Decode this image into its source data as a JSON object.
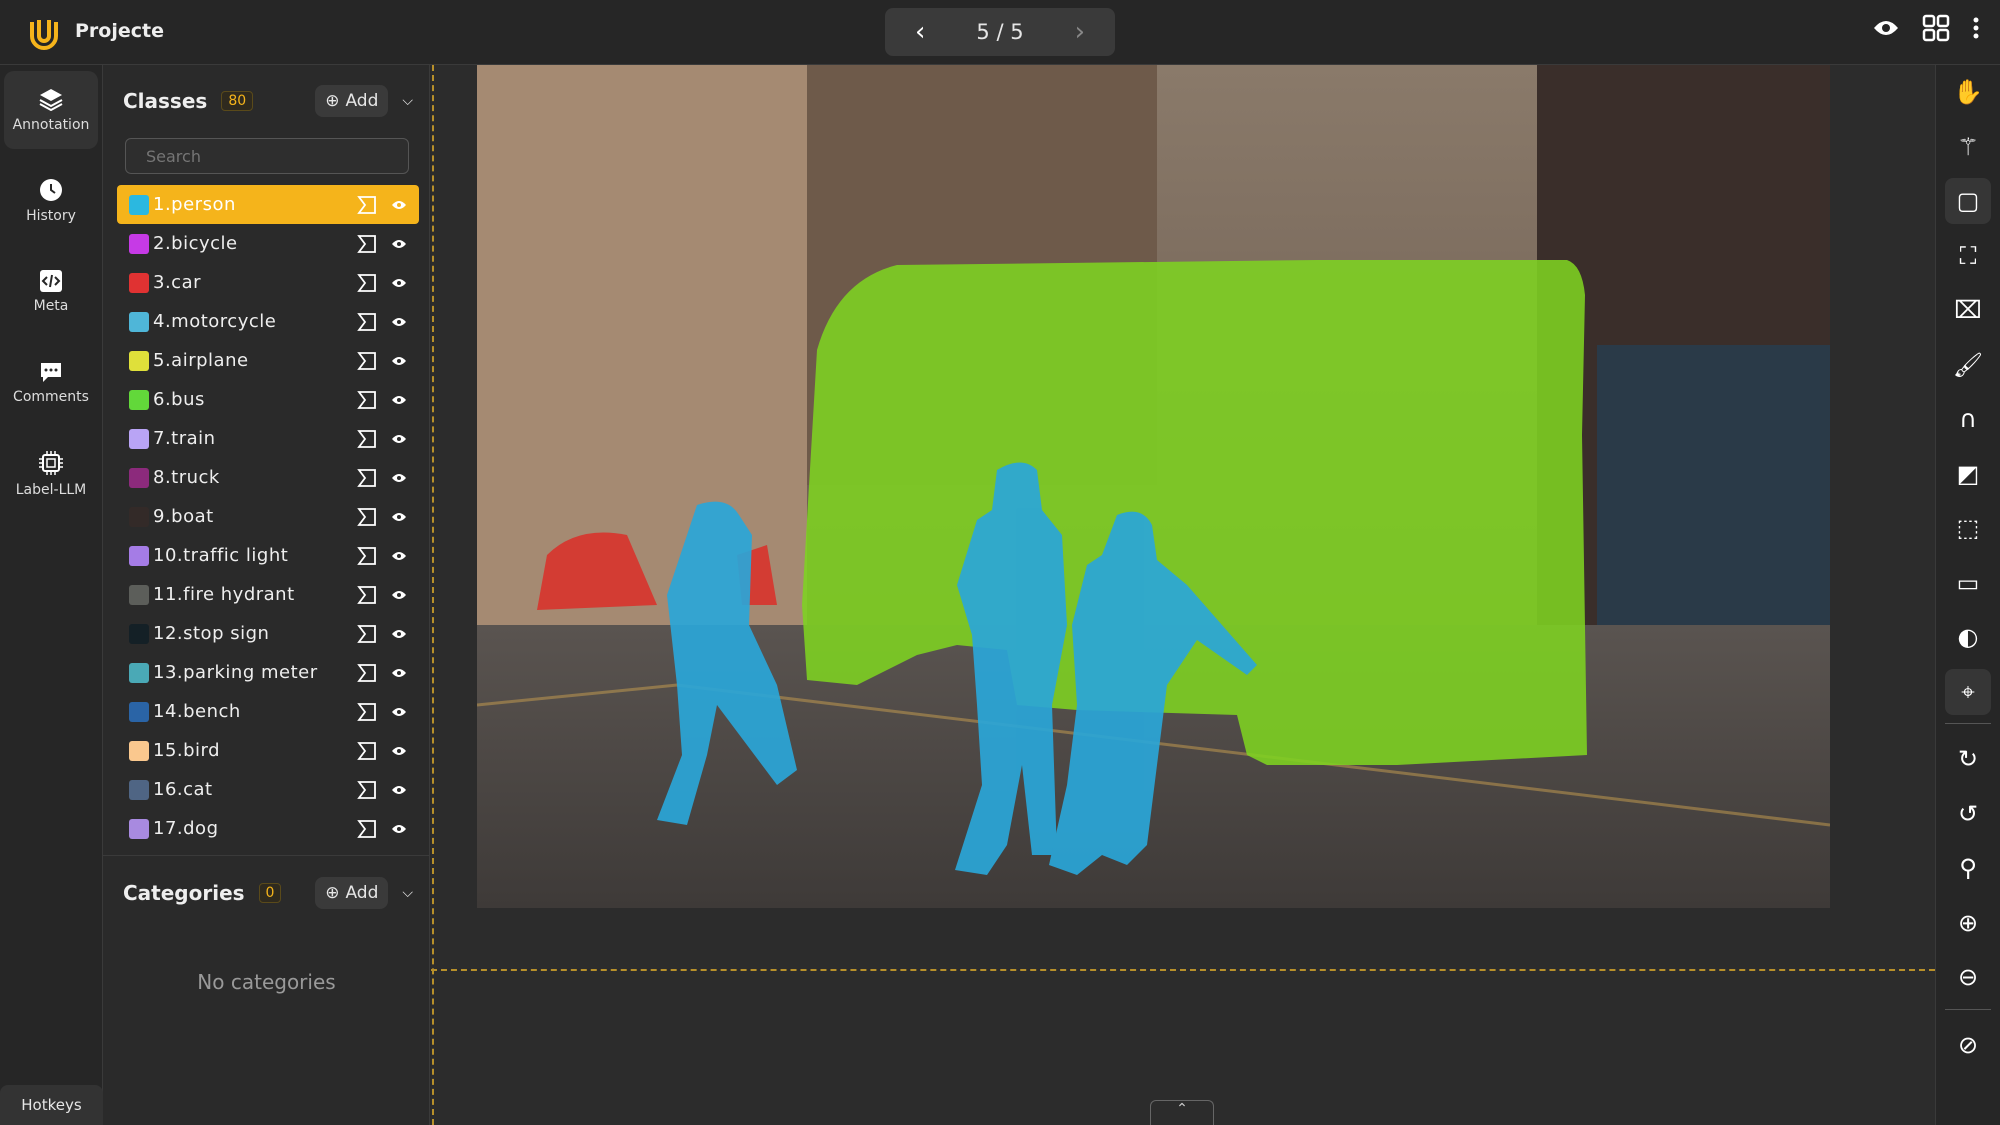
{
  "header": {
    "project": "Projecte",
    "pager": "5 / 5",
    "prev_icon": "chevron-left-icon",
    "next_icon": "chevron-right-icon"
  },
  "nav": [
    {
      "label": "Annotation",
      "icon": "layers-icon",
      "active": true
    },
    {
      "label": "History",
      "icon": "clock-icon"
    },
    {
      "label": "Meta",
      "icon": "code-icon"
    },
    {
      "label": "Comments",
      "icon": "comment-icon"
    },
    {
      "label": "Label-LLM",
      "icon": "chip-icon"
    }
  ],
  "hotkeys": "Hotkeys",
  "classes": {
    "title": "Classes",
    "count": "80",
    "add_label": "Add",
    "search_placeholder": "Search",
    "items": [
      {
        "label": "1.person",
        "color": "#2bb8e0",
        "selected": true
      },
      {
        "label": "2.bicycle",
        "color": "#c63ae6"
      },
      {
        "label": "3.car",
        "color": "#e03232"
      },
      {
        "label": "4.motorcycle",
        "color": "#4fb6d8"
      },
      {
        "label": "5.airplane",
        "color": "#dfe03a"
      },
      {
        "label": "6.bus",
        "color": "#62d83a"
      },
      {
        "label": "7.train",
        "color": "#b9a4f5"
      },
      {
        "label": "8.truck",
        "color": "#8c2a7c"
      },
      {
        "label": "9.boat",
        "color": "#332a28"
      },
      {
        "label": "10.traffic light",
        "color": "#a57ce6"
      },
      {
        "label": "11.fire hydrant",
        "color": "#5c5e5a"
      },
      {
        "label": "12.stop sign",
        "color": "#142026"
      },
      {
        "label": "13.parking meter",
        "color": "#4aa9b6"
      },
      {
        "label": "14.bench",
        "color": "#2a64a6"
      },
      {
        "label": "15.bird",
        "color": "#fac88e"
      },
      {
        "label": "16.cat",
        "color": "#4f6584"
      },
      {
        "label": "17.dog",
        "color": "#a88ae0"
      }
    ]
  },
  "categories": {
    "title": "Categories",
    "count": "0",
    "add_label": "Add",
    "empty": "No categories"
  },
  "tools": [
    "hand-icon",
    "magic-wand-icon",
    "rectangle-icon",
    "auto-segment-icon",
    "polygon-icon",
    "brush-icon",
    "magnet-icon",
    "eraser-icon",
    "edit-points-icon",
    "comment-icon",
    "opacity-icon",
    "crosshair-icon",
    "rotate-right-icon",
    "rotate-left-icon",
    "zoom-fit-icon",
    "zoom-in-icon",
    "zoom-out-icon",
    "hide-icon"
  ],
  "colors": {
    "accent": "#f5b41b",
    "person_mask": "#2aa6d8",
    "bus_mask": "#7ed321"
  }
}
